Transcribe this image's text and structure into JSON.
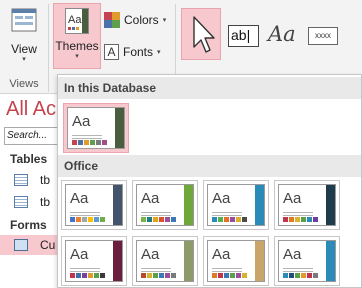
{
  "ribbon": {
    "view_label": "View",
    "views_group_label": "Views",
    "themes_label": "Themes",
    "colors_label": "Colors",
    "fonts_label": "Fonts",
    "fonts_icon_glyph": "A",
    "textbox_control_text": "ab|",
    "label_control_text": "Aa",
    "button_control_text": "xxxx"
  },
  "nav": {
    "title": "All Ac",
    "search_placeholder": "Search...",
    "tables_header": "Tables",
    "table_items": [
      {
        "label": "tb"
      },
      {
        "label": "tb"
      }
    ],
    "forms_header": "Forms",
    "form_items": [
      {
        "label": "Cu"
      }
    ]
  },
  "dropdown": {
    "in_database_header": "In this Database",
    "office_header": "Office",
    "theme_sample_text": "Aa",
    "current_theme": {
      "bar": "#4a5d3e",
      "swatches": [
        "#c4434f",
        "#4a72a8",
        "#e09a2e",
        "#5e9e4c",
        "#7a7a7a",
        "#a14e8c"
      ]
    },
    "office_themes": [
      {
        "bar": "#44546a",
        "swatches": [
          "#4472c4",
          "#ed7d31",
          "#a5a5a5",
          "#ffc000",
          "#5b9bd5",
          "#70ad47"
        ]
      },
      {
        "bar": "#6ea83a",
        "swatches": [
          "#7cb342",
          "#1b7d87",
          "#e3a21a",
          "#d9542c",
          "#9c4d9c",
          "#3c78b4"
        ]
      },
      {
        "bar": "#2a8ab8",
        "swatches": [
          "#2a8ab8",
          "#57b14a",
          "#e76f2c",
          "#9b4c9c",
          "#d7b12d",
          "#4a4a4a"
        ]
      },
      {
        "bar": "#1e3c4c",
        "swatches": [
          "#c2344e",
          "#e07a26",
          "#d9b32e",
          "#5aa04a",
          "#2a8ab8",
          "#6c3f9e"
        ]
      },
      {
        "bar": "#6b1f3f",
        "swatches": [
          "#c2344e",
          "#3c6ea8",
          "#7c3f9e",
          "#e09a2e",
          "#5aa04a",
          "#3a3a3a"
        ]
      },
      {
        "bar": "#8d9a6a",
        "swatches": [
          "#b54a2e",
          "#d9b32e",
          "#5aa04a",
          "#3c78b4",
          "#9c4d9c",
          "#7a7a7a"
        ]
      },
      {
        "bar": "#c9a56a",
        "swatches": [
          "#e07a26",
          "#c2344e",
          "#3c78b4",
          "#5aa04a",
          "#9c4d9c",
          "#d9b32e"
        ]
      },
      {
        "bar": "#2a8ab8",
        "swatches": [
          "#2a8ab8",
          "#1e4e79",
          "#5aa04a",
          "#e09a2e",
          "#c2344e",
          "#7a7a7a"
        ]
      }
    ]
  },
  "colors": {
    "accent_pink": "#f7c9cf",
    "nav_title": "#c4434f"
  }
}
